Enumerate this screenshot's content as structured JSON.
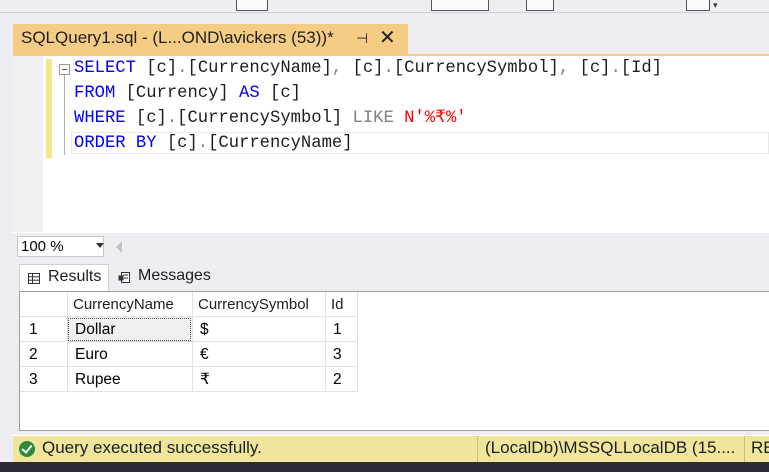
{
  "tab": {
    "title": "SQLQuery1.sql - (L...OND\\avickers (53))*",
    "pin_glyph": "⊣",
    "close_glyph": "✕"
  },
  "editor": {
    "lines": [
      [
        {
          "t": "SELECT",
          "c": "kw"
        },
        {
          "t": " ",
          "c": "id"
        },
        {
          "t": "[c]",
          "c": "id"
        },
        {
          "t": ".",
          "c": "pn"
        },
        {
          "t": "[CurrencyName]",
          "c": "id"
        },
        {
          "t": ",",
          "c": "pn"
        },
        {
          "t": " [c]",
          "c": "id"
        },
        {
          "t": ".",
          "c": "pn"
        },
        {
          "t": "[CurrencySymbol]",
          "c": "id"
        },
        {
          "t": ",",
          "c": "pn"
        },
        {
          "t": " [c]",
          "c": "id"
        },
        {
          "t": ".",
          "c": "pn"
        },
        {
          "t": "[Id]",
          "c": "id"
        }
      ],
      [
        {
          "t": "FROM",
          "c": "kw"
        },
        {
          "t": " [Currency] ",
          "c": "id"
        },
        {
          "t": "AS",
          "c": "kw"
        },
        {
          "t": " [c]",
          "c": "id"
        }
      ],
      [
        {
          "t": "WHERE",
          "c": "kw"
        },
        {
          "t": " [c]",
          "c": "id"
        },
        {
          "t": ".",
          "c": "pn"
        },
        {
          "t": "[CurrencySymbol] ",
          "c": "id"
        },
        {
          "t": "LIKE",
          "c": "op"
        },
        {
          "t": " ",
          "c": "id"
        },
        {
          "t": "N'%₹%'",
          "c": "st"
        }
      ],
      [
        {
          "t": "ORDER BY",
          "c": "kw"
        },
        {
          "t": " [c]",
          "c": "id"
        },
        {
          "t": ".",
          "c": "pn"
        },
        {
          "t": "[CurrencyName]",
          "c": "id"
        }
      ]
    ]
  },
  "zoom": {
    "value": "100 %"
  },
  "results_tabs": {
    "results": "Results",
    "messages": "Messages"
  },
  "grid": {
    "columns": [
      "CurrencyName",
      "CurrencySymbol",
      "Id"
    ],
    "rows": [
      {
        "n": "1",
        "cells": [
          "Dollar",
          "$",
          "1"
        ]
      },
      {
        "n": "2",
        "cells": [
          "Euro",
          "€",
          "3"
        ]
      },
      {
        "n": "3",
        "cells": [
          "Rupee",
          "₹",
          "2"
        ]
      }
    ]
  },
  "status": {
    "message": "Query executed successfully.",
    "server": "(LocalDb)\\MSSQLLocalDB (15....",
    "next_truncated": "RE"
  },
  "colors": {
    "tab_active": "#f5cc84",
    "status_bar": "#f0e59c",
    "keyword": "#0000ff",
    "string": "#ff0000",
    "success": "#2c8a3a"
  }
}
